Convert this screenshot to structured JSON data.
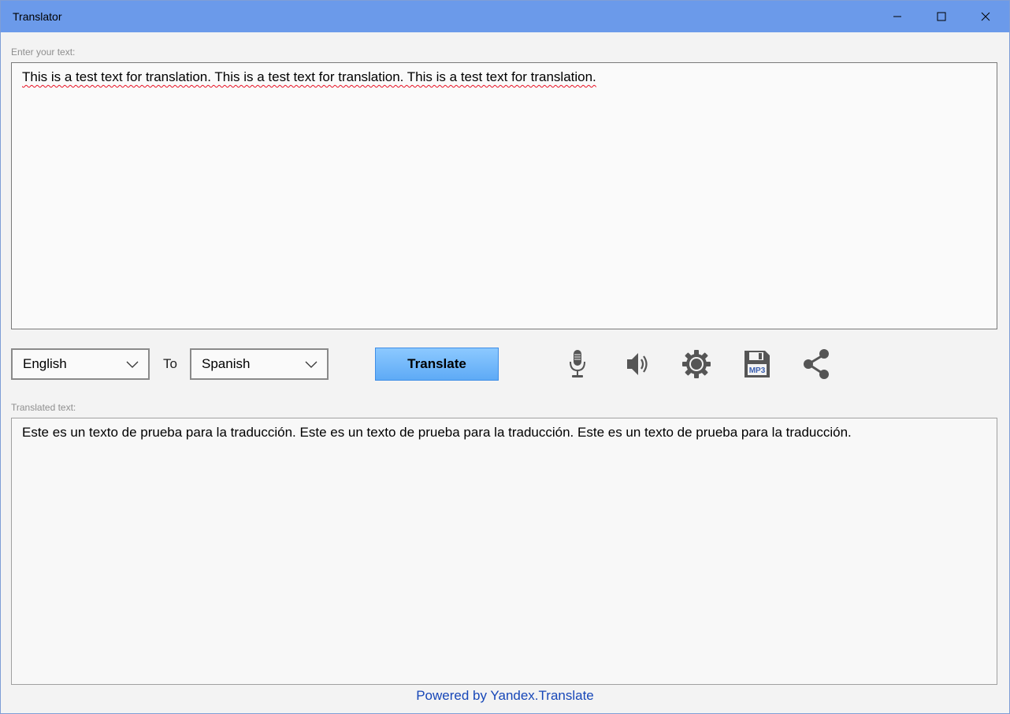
{
  "window": {
    "title": "Translator",
    "accent_color": "#6b9aea"
  },
  "input": {
    "label": "Enter your text:",
    "value": "This is a test text for translation. This is a test text for translation. This is a test text for translation."
  },
  "languages": {
    "from": "English",
    "to_label": "To",
    "to": "Spanish"
  },
  "toolbar": {
    "translate_label": "Translate",
    "icons": [
      "microphone-icon",
      "speaker-icon",
      "gear-icon",
      "save-mp3-icon",
      "share-icon"
    ],
    "mp3_badge": "MP3"
  },
  "output": {
    "label": "Translated text:",
    "value": "Este es un texto de prueba para la traducción. Este es un texto de prueba para la traducción. Este es un texto de prueba para la traducción."
  },
  "footer": {
    "link_text": "Powered by Yandex.Translate",
    "link_color": "#1747b8"
  }
}
